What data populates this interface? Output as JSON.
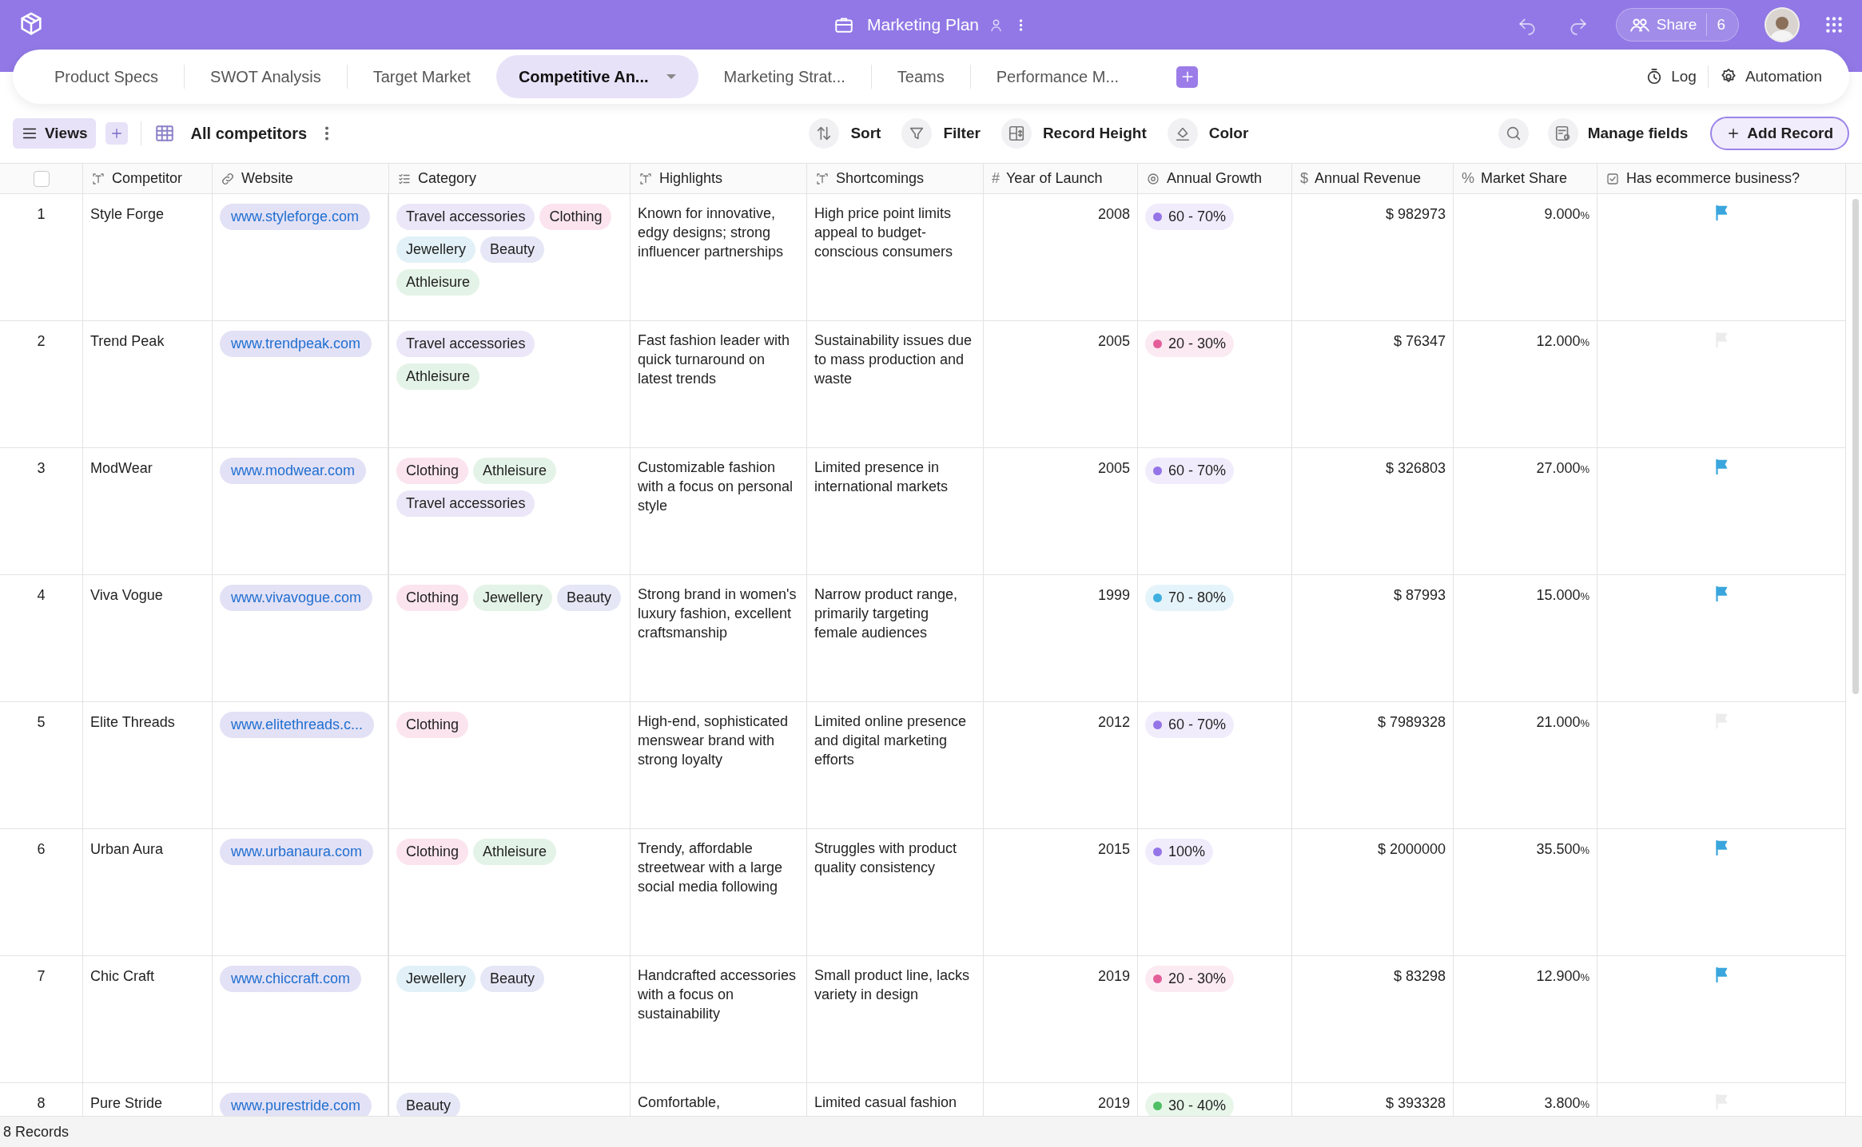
{
  "app": {
    "title": "Marketing Plan",
    "share_label": "Share",
    "share_count": "6"
  },
  "tabs": [
    {
      "label": "Product Specs",
      "selected": false
    },
    {
      "label": "SWOT Analysis",
      "selected": false
    },
    {
      "label": "Target Market",
      "selected": false
    },
    {
      "label": "Competitive An...",
      "selected": true
    },
    {
      "label": "Marketing Strat...",
      "selected": false
    },
    {
      "label": "Teams",
      "selected": false
    },
    {
      "label": "Performance M...",
      "selected": false
    }
  ],
  "tab_actions": [
    {
      "kind": "log",
      "label": "Log"
    },
    {
      "kind": "automation",
      "label": "Automation"
    }
  ],
  "toolbar": {
    "views_label": "Views",
    "view_name": "All competitors",
    "tools": [
      {
        "kind": "sort",
        "label": "Sort"
      },
      {
        "kind": "filter",
        "label": "Filter"
      },
      {
        "kind": "height",
        "label": "Record Height"
      },
      {
        "kind": "color",
        "label": "Color"
      }
    ],
    "manage_label": "Manage fields",
    "add_label": "Add Record"
  },
  "table": {
    "all_selected": false,
    "columns": [
      {
        "kind": "text",
        "label": "Competitor"
      },
      {
        "kind": "link",
        "label": "Website"
      },
      {
        "kind": "multi",
        "label": "Category"
      },
      {
        "kind": "text",
        "label": "Highlights"
      },
      {
        "kind": "text",
        "label": "Shortcomings"
      },
      {
        "kind": "glyph",
        "glyph": "#",
        "label": "Year of Launch"
      },
      {
        "kind": "single",
        "label": "Annual Growth"
      },
      {
        "kind": "glyph",
        "glyph": "$",
        "label": "Annual Revenue"
      },
      {
        "kind": "glyph",
        "glyph": "%",
        "label": "Market Share"
      },
      {
        "kind": "check",
        "label": "Has ecommerce business?"
      }
    ],
    "rows": [
      {
        "number": "1",
        "competitor": "Style Forge",
        "website": "www.styleforge.com",
        "categories": [
          {
            "label": "Travel accessories",
            "color": "#ebe7f8"
          },
          {
            "label": "Clothing",
            "color": "#fbe4ee"
          },
          {
            "label": "Jewellery",
            "color": "#e2f1f8"
          },
          {
            "label": "Beauty",
            "color": "#e5e7f6"
          },
          {
            "label": "Athleisure",
            "color": "#e4f3e7"
          }
        ],
        "highlights": "Known for innovative, edgy designs; strong influencer partnerships",
        "shortcomings": "High price point limits appeal to budget-conscious consumers",
        "year": "2008",
        "growth": {
          "label": "60 - 70%",
          "color": "#9474e6"
        },
        "revenue": "$ 982973",
        "share": "9.000",
        "share_unit": "%",
        "ecommerce": true
      },
      {
        "number": "2",
        "competitor": "Trend Peak",
        "website": "www.trendpeak.com",
        "categories": [
          {
            "label": "Travel accessories",
            "color": "#ebe7f8"
          },
          {
            "label": "Athleisure",
            "color": "#e4f3e7"
          }
        ],
        "highlights": "Fast fashion leader with quick turnaround on latest trends",
        "shortcomings": "Sustainability issues due to mass production and waste",
        "year": "2005",
        "growth": {
          "label": "20 - 30%",
          "color": "#e45f9a"
        },
        "revenue": "$ 76347",
        "share": "12.000",
        "share_unit": "%",
        "ecommerce": false
      },
      {
        "number": "3",
        "competitor": "ModWear",
        "website": "www.modwear.com",
        "categories": [
          {
            "label": "Clothing",
            "color": "#fbe4ee"
          },
          {
            "label": "Athleisure",
            "color": "#e4f3e7"
          },
          {
            "label": "Travel accessories",
            "color": "#ebe7f8"
          }
        ],
        "highlights": "Customizable fashion with a focus on personal style",
        "shortcomings": "Limited presence in international markets",
        "year": "2005",
        "growth": {
          "label": "60 - 70%",
          "color": "#9474e6"
        },
        "revenue": "$ 326803",
        "share": "27.000",
        "share_unit": "%",
        "ecommerce": true
      },
      {
        "number": "4",
        "competitor": "Viva Vogue",
        "website": "www.vivavogue.com",
        "categories": [
          {
            "label": "Clothing",
            "color": "#fbe4ee"
          },
          {
            "label": "Jewellery",
            "color": "#e4f3e7"
          },
          {
            "label": "Beauty",
            "color": "#e5e7f6"
          }
        ],
        "highlights": "Strong brand in women's luxury fashion, excellent craftsmanship",
        "shortcomings": "Narrow product range, primarily targeting female audiences",
        "year": "1999",
        "growth": {
          "label": "70 - 80%",
          "color": "#3fb0e0"
        },
        "revenue": "$ 87993",
        "share": "15.000",
        "share_unit": "%",
        "ecommerce": true
      },
      {
        "number": "5",
        "competitor": "Elite Threads",
        "website": "www.elitethreads.c...",
        "categories": [
          {
            "label": "Clothing",
            "color": "#fbe4ee"
          }
        ],
        "highlights": "High-end, sophisticated menswear brand with strong loyalty",
        "shortcomings": "Limited online presence and digital marketing efforts",
        "year": "2012",
        "growth": {
          "label": "60 - 70%",
          "color": "#9474e6"
        },
        "revenue": "$ 7989328",
        "share": "21.000",
        "share_unit": "%",
        "ecommerce": false
      },
      {
        "number": "6",
        "competitor": "Urban Aura",
        "website": "www.urbanaura.com",
        "categories": [
          {
            "label": "Clothing",
            "color": "#fbe4ee"
          },
          {
            "label": "Athleisure",
            "color": "#e4f3e7"
          }
        ],
        "highlights": "Trendy, affordable streetwear with a large social media following",
        "shortcomings": "Struggles with product quality consistency",
        "year": "2015",
        "growth": {
          "label": "100%",
          "color": "#9474e6"
        },
        "revenue": "$ 2000000",
        "share": "35.500",
        "share_unit": "%",
        "ecommerce": true
      },
      {
        "number": "7",
        "competitor": "Chic Craft",
        "website": "www.chiccraft.com",
        "categories": [
          {
            "label": "Jewellery",
            "color": "#e2f1f8"
          },
          {
            "label": "Beauty",
            "color": "#e5e7f6"
          }
        ],
        "highlights": "Handcrafted accessories with a focus on sustainability",
        "shortcomings": "Small product line, lacks variety in design",
        "year": "2019",
        "growth": {
          "label": "20 - 30%",
          "color": "#e45f9a"
        },
        "revenue": "$ 83298",
        "share": "12.900",
        "share_unit": "%",
        "ecommerce": true
      },
      {
        "number": "8",
        "competitor": "Pure Stride",
        "website": "www.purestride.com",
        "categories": [
          {
            "label": "Beauty",
            "color": "#e5e7f6"
          }
        ],
        "highlights": "Comfortable,",
        "shortcomings": "Limited casual fashion",
        "year": "2019",
        "growth": {
          "label": "30 - 40%",
          "color": "#4fbf63"
        },
        "revenue": "$ 393328",
        "share": "3.800",
        "share_unit": "%",
        "ecommerce": false
      }
    ]
  },
  "footer": {
    "records": "8 Records"
  }
}
